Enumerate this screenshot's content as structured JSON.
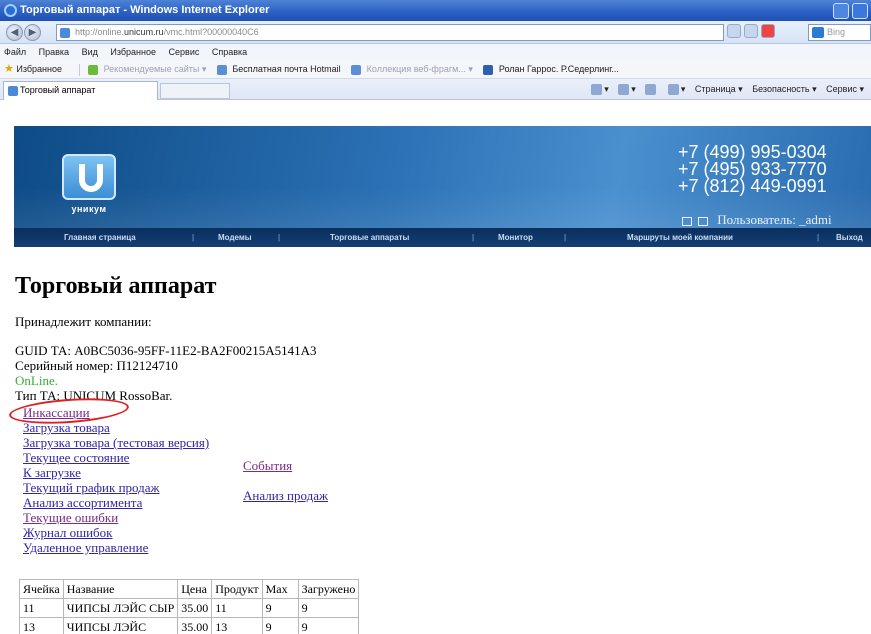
{
  "window": {
    "title": "Торговый аппарат - Windows Internet Explorer"
  },
  "address": {
    "url_prefix": "http://online.",
    "url_domain": "unicum.ru",
    "url_rest": "/vmc.html?00000040C6",
    "search_placeholder": "Bing"
  },
  "menu": [
    "Файл",
    "Правка",
    "Вид",
    "Избранное",
    "Сервис",
    "Справка"
  ],
  "favorites": {
    "label": "Избранное",
    "items": [
      {
        "label": "Рекомендуемые сайты ▾",
        "dim": true
      },
      {
        "label": "Бесплатная почта Hotmail",
        "dim": false
      },
      {
        "label": "Коллекция веб-фрагм... ▾",
        "dim": true
      },
      {
        "label": "Ролан Гаррос. Р.Седерлинг...",
        "dim": false
      }
    ]
  },
  "tabs": [
    {
      "label": "Торговый аппарат"
    }
  ],
  "commandbar": [
    "Страница ▾",
    "Безопасность ▾",
    "Сервис ▾"
  ],
  "banner": {
    "logo_text": "уникум",
    "phones": [
      "+7 (499) 995-0304",
      "+7 (495) 933-7770",
      "+7 (812) 449-0991"
    ],
    "user_label": "Пользователь: _admi"
  },
  "nav": {
    "items": [
      "Главная страница",
      "Модемы",
      "Торговые аппараты",
      "Монитор",
      "Маршруты моей компании",
      "Выход"
    ]
  },
  "page": {
    "title": "Торговый аппарат",
    "owner": "Принадлежит компании:",
    "guid": "GUID ТА: A0BC5036-95FF-11E2-BA2F00215A5141A3",
    "serial": "Серийный номер: П12124710",
    "status": "OnLine.",
    "type": "Тип ТА: UNICUM RossoBar."
  },
  "links": {
    "left": [
      "Инкассации",
      "Загрузка товара",
      "Загрузка товара (тестовая версия)",
      "Текущее состояние",
      "К загрузке",
      "Текущий график продаж",
      "Анализ ассортимента",
      "Текущие ошибки",
      "Журнал ошибок",
      "Удаленное управление"
    ],
    "right": [
      "События",
      "Анализ продаж"
    ]
  },
  "table": {
    "headers": [
      "Ячейка",
      "Название",
      "Цена",
      "Продукт",
      "Max",
      "Загружено"
    ],
    "rows": [
      [
        "11",
        "ЧИПСЫ ЛЭЙС СЫР",
        "35.00",
        "11",
        "9",
        "9"
      ],
      [
        "13",
        "ЧИПСЫ ЛЭЙС",
        "35.00",
        "13",
        "9",
        "9"
      ]
    ]
  },
  "colors": {
    "online": "#34b034",
    "link": "#3124a8",
    "link_visited": "#7a2a8a",
    "highlight_ring": "#dd2222",
    "banner_blue": "#2c72b6",
    "nav_dark": "#0b2f5e"
  }
}
